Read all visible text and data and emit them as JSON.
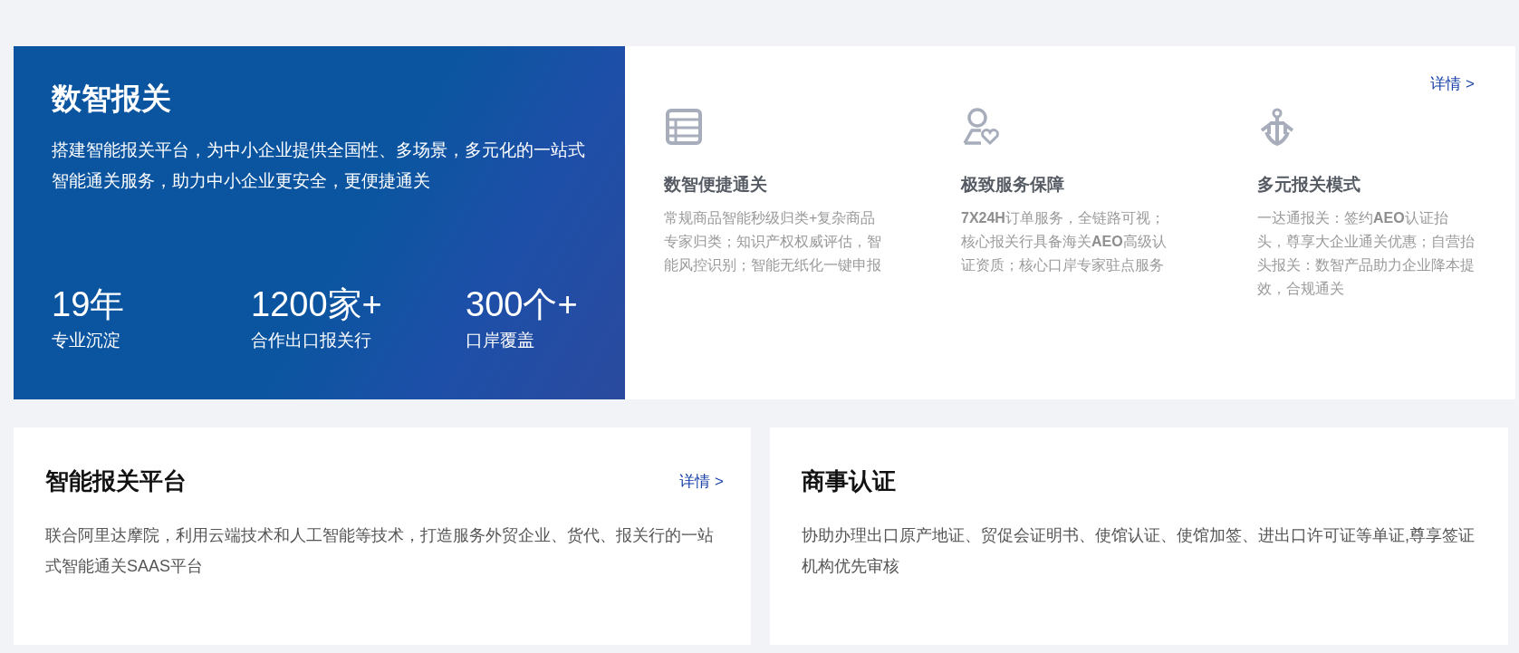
{
  "hero": {
    "title": "数智报关",
    "description": "搭建智能报关平台，为中小企业提供全国性、多场景，多元化的一站式智能通关服务，助力中小企业更安全，更便捷通关",
    "stats": [
      {
        "value": "19年",
        "label": "专业沉淀"
      },
      {
        "value": "1200家+",
        "label": "合作出口报关行"
      },
      {
        "value": "300个+",
        "label": "口岸覆盖"
      }
    ]
  },
  "features_panel": {
    "link": "详情 >",
    "features": [
      {
        "kind": "list",
        "title": "数智便捷通关",
        "description": "常规商品智能秒级归类+复杂商品专家归类；知识产权权威评估，智能风控识别；智能无纸化一键申报"
      },
      {
        "kind": "service",
        "title": "极致服务保障",
        "description": "**7X24H**订单服务，全链路可视；核心报关行具备海关**AEO**高级认证资质；核心口岸专家驻点服务"
      },
      {
        "kind": "anchor",
        "title": "多元报关模式",
        "description": "一达通报关：签约**AEO**认证抬头，尊享大企业通关优惠；自营抬头报关：数智产品助力企业降本提效，合规通关"
      }
    ]
  },
  "cards": [
    {
      "title": "智能报关平台",
      "link": "详情 >",
      "description": "联合阿里达摩院，利用云端技术和人工智能等技术，打造服务外贸企业、货代、报关行的一站式智能通关SAAS平台"
    },
    {
      "title": "商事认证",
      "description": "协助办理出口原产地证、贸促会证明书、使馆认证、使馆加签、进出口许可证等单证,尊享签证机构优先审核"
    }
  ]
}
